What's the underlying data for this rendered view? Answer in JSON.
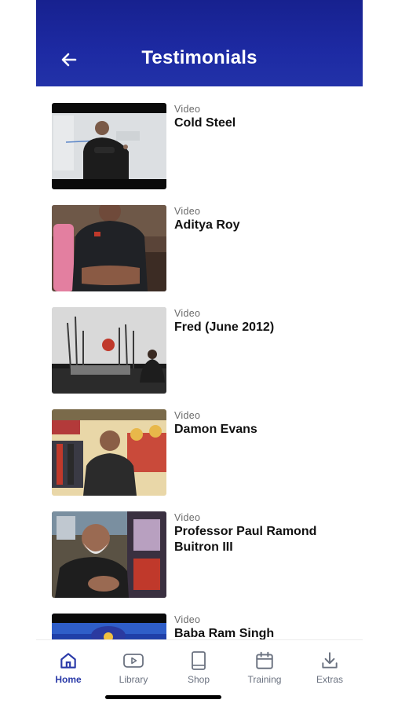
{
  "header": {
    "title": "Testimonials",
    "back_icon": "arrow-left-icon"
  },
  "items": [
    {
      "kind": "Video",
      "title": "Cold Steel"
    },
    {
      "kind": "Video",
      "title": "Aditya Roy"
    },
    {
      "kind": "Video",
      "title": "Fred (June 2012)"
    },
    {
      "kind": "Video",
      "title": "Damon Evans"
    },
    {
      "kind": "Video",
      "title": "Professor Paul Ramond Buitron III"
    },
    {
      "kind": "Video",
      "title": "Baba Ram Singh"
    }
  ],
  "tabs": [
    {
      "label": "Home",
      "icon": "home-icon",
      "active": true
    },
    {
      "label": "Library",
      "icon": "video-library-icon",
      "active": false
    },
    {
      "label": "Shop",
      "icon": "book-icon",
      "active": false
    },
    {
      "label": "Training",
      "icon": "calendar-icon",
      "active": false
    },
    {
      "label": "Extras",
      "icon": "download-icon",
      "active": false
    }
  ],
  "colors": {
    "header": "#1b26a0",
    "active_tab": "#2a3aa8",
    "inactive_tab": "#6b7280"
  }
}
